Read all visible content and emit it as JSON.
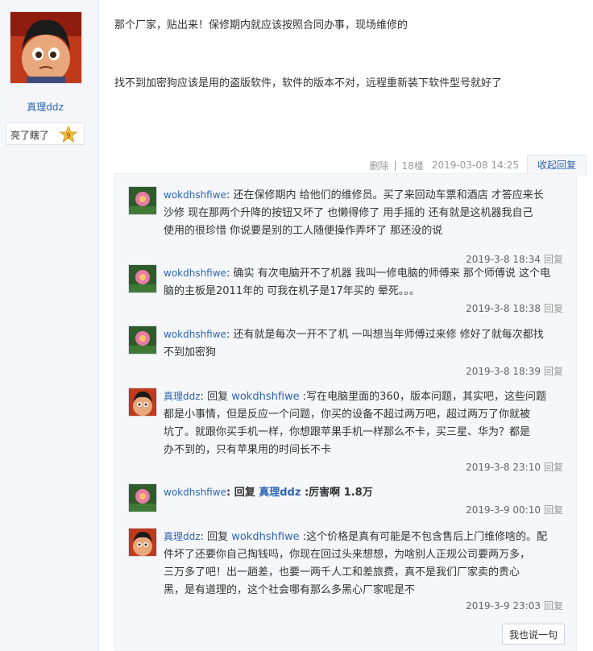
{
  "post": {
    "author": "真理ddz",
    "rank_label": "亮了瞎了",
    "rank_level": "9",
    "content": [
      "那个厂家，贴出来！保修期内就应该按照合同办事，现场维修的",
      "找不到加密狗应该是用的盗版软件，软件的版本不对，远程重新装下软件型号就好了"
    ],
    "meta": {
      "delete": "删除",
      "sep": "|",
      "floor": "18楼",
      "time": "2019-03-08 14:25",
      "collapse": "收起回复"
    }
  },
  "replies": [
    {
      "user": "wokdhshfiwe",
      "text_lines": [
        "还在保修期内 给他们的维修员。买了来回动车票和酒店 才答应来长",
        "沙修 现在那两个升降的按钮又坏了 也懒得修了 用手摇的 还有就是这机器我自己",
        "使用的很珍惜 你说要是别的工人随便操作弄坏了 那还没的说"
      ],
      "time": "2019-3-8 18:34",
      "reply": "回复"
    },
    {
      "user": "wokdhshfiwe",
      "text_lines": [
        "确实 有次电脑开不了机器 我叫一修电脑的师傅来 那个师傅说 这个电",
        "脑的主板是2011年的 可我在机子是17年买的 晕死。。。"
      ],
      "time": "2019-3-8 18:38",
      "reply": "回复"
    },
    {
      "user": "wokdhshfiwe",
      "text_lines": [
        "还有就是每次一开不了机 一叫想当年师傅过来修 修好了就每次都找",
        "不到加密狗"
      ],
      "time": "2019-3-8 18:39",
      "reply": "回复"
    },
    {
      "user": "真理ddz",
      "reply_to": "wokdhshfiwe",
      "reply_word": "回复",
      "text_lines": [
        ":写在电脑里面的360，版本问题，其实吧，这些问题",
        "都是小事情，但是反应一个问题，你买的设备不超过两万吧，超过两万了你就被",
        "坑了。就跟你买手机一样，你想跟苹果手机一样那么不卡，买三星、华为？都是",
        "办不到的，只有苹果用的时间长不卡"
      ],
      "time": "2019-3-8 23:10",
      "reply": "回复"
    },
    {
      "user": "wokdhshfiwe",
      "reply_to": "真理ddz",
      "reply_word": "回复",
      "text_lines": [
        ":厉害啊 1.8万"
      ],
      "time": "2019-3-9 00:10",
      "reply": "回复"
    },
    {
      "user": "真理ddz",
      "reply_to": "wokdhshfiwe",
      "reply_word": "回复",
      "text_lines": [
        ":这个价格是真有可能是不包含售后上门维修啥的。配",
        "件坏了还要你自己掏钱吗，你现在回过头来想想，为啥别人正规公司要两万多，",
        "三万多了吧！出一趟差，也要一两千人工和差旅费，真不是我们厂家卖的贵心",
        "黑，是有道理的，这个社会哪有那么多黑心厂家呢是不"
      ],
      "time": "2019-3-9 23:03",
      "reply": "回复"
    }
  ],
  "say_button": "我也说一句",
  "colors": {
    "link": "#2d64b3",
    "panel": "#f5f7fa",
    "sidebar": "#f4f6fa"
  }
}
